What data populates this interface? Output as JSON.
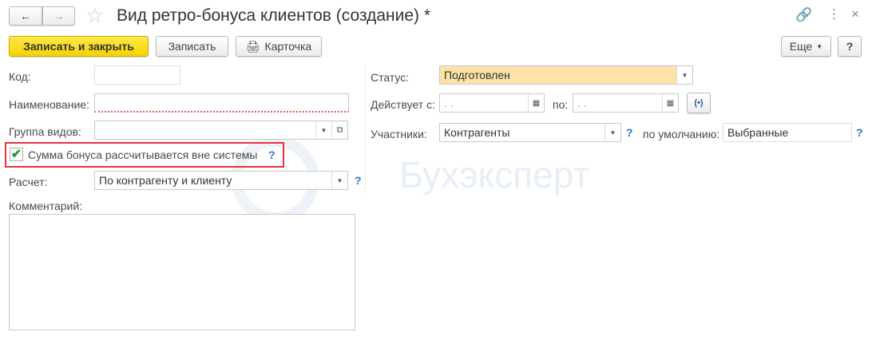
{
  "window": {
    "title": "Вид ретро-бонуса клиентов (создание) *"
  },
  "toolbar": {
    "save_close": "Записать и закрыть",
    "save": "Записать",
    "card": "Карточка",
    "more": "Еще",
    "help": "?"
  },
  "form": {
    "code": {
      "label": "Код:",
      "value": ""
    },
    "name": {
      "label": "Наименование:",
      "value": ""
    },
    "group": {
      "label": "Группа видов:",
      "value": ""
    },
    "checkbox": {
      "label": "Сумма бонуса рассчитывается вне системы",
      "checked": true,
      "help": "?"
    },
    "calc": {
      "label": "Расчет:",
      "value": "По контрагенту и клиенту",
      "help": "?"
    },
    "comment": {
      "label": "Комментарий:",
      "value": ""
    },
    "status": {
      "label": "Статус:",
      "value": "Подготовлен"
    },
    "from": {
      "label": "Действует с:",
      "value": " .  ."
    },
    "to": {
      "label": "по:",
      "value": " .  ."
    },
    "participants": {
      "label": "Участники:",
      "value": "Контрагенты",
      "help": "?"
    },
    "default": {
      "label": "по умолчанию:",
      "value": "Выбранные",
      "help": "?"
    }
  },
  "watermark": "Бухэксперт",
  "colors": {
    "accent": "#f5d300",
    "status_bg": "#fde3a7",
    "highlight": "#e8323c",
    "help": "#2a73c9"
  }
}
